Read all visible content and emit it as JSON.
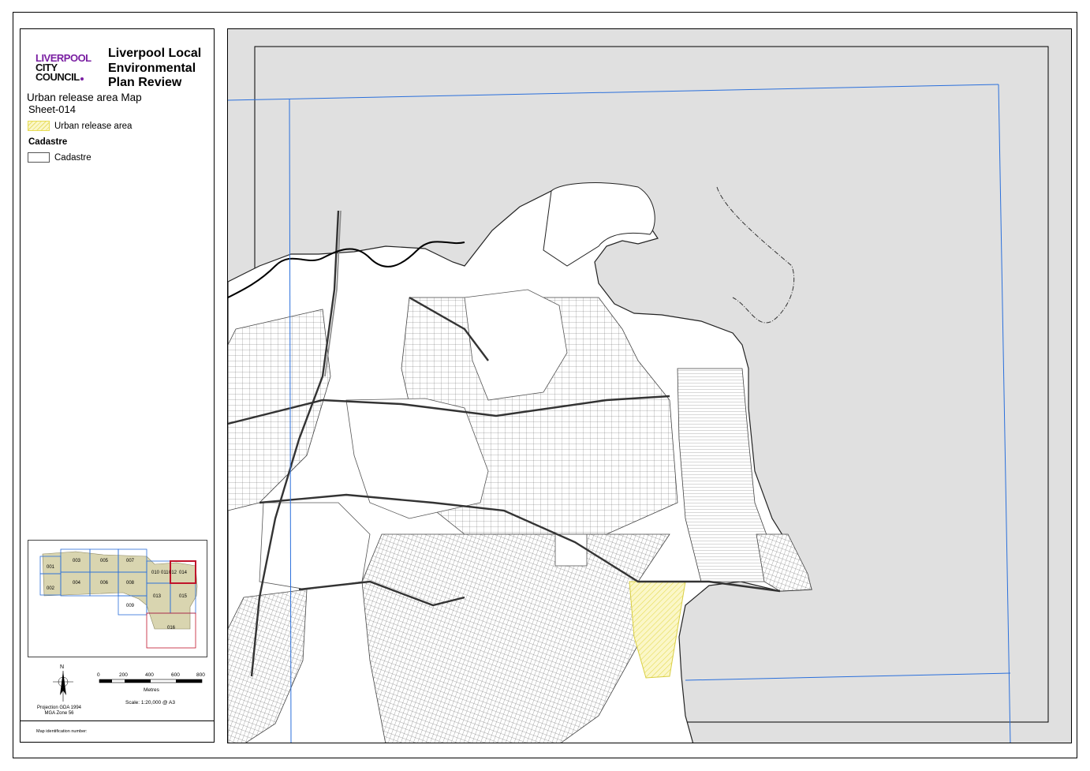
{
  "logo": {
    "line1": "LIVERPOOL",
    "line2": "CITY",
    "line3": "COUNCIL"
  },
  "title": {
    "line1": "Liverpool Local",
    "line2": "Environmental",
    "line3": "Plan Review"
  },
  "subtitle": "Urban release area Map",
  "sheet": "Sheet-014",
  "legend": {
    "urban_release_label": "Urban release area",
    "cadastre_heading": "Cadastre",
    "cadastre_label": "Cadastre"
  },
  "index_map": {
    "sheets": [
      "001",
      "002",
      "003",
      "004",
      "005",
      "006",
      "007",
      "008",
      "009",
      "010",
      "011",
      "012",
      "013",
      "014",
      "015",
      "016"
    ],
    "highlighted": "014"
  },
  "north_label": "N",
  "scale_bar": {
    "ticks": [
      "0",
      "200",
      "400",
      "600",
      "800"
    ],
    "unit": "Metres",
    "text": "Scale: 1:20,000 @ A3"
  },
  "projection": {
    "line1": "Projection GDA 1994",
    "line2": "MGA Zone 56"
  },
  "map_id_label": "Map identification number:",
  "colors": {
    "council_purple": "#7a1fa2",
    "urban_release_fill": "#fbf7c8",
    "urban_release_stroke": "#e6dc55",
    "grid_blue": "#2a6fdb",
    "index_highlight": "#c0142b",
    "index_fill": "#d9d5b0",
    "map_background": "#e0e0e0"
  }
}
